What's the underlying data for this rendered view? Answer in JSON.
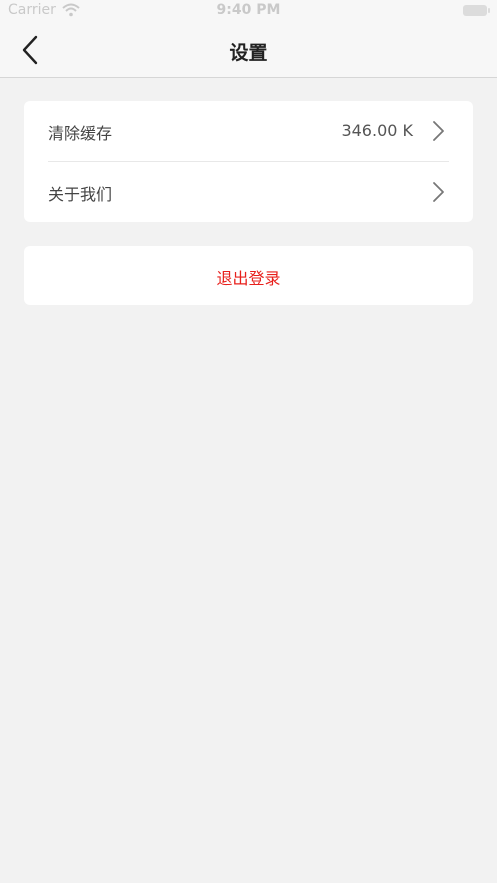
{
  "status_bar": {
    "carrier": "Carrier",
    "time": "9:40 PM",
    "wifi_icon": "wifi-icon",
    "battery_icon": "battery-icon"
  },
  "nav": {
    "title": "设置",
    "back_icon": "chevron-left-icon"
  },
  "settings": {
    "items": [
      {
        "label": "清除缓存",
        "value": "346.00 K",
        "icon": "chevron-right-icon"
      },
      {
        "label": "关于我们",
        "value": "",
        "icon": "chevron-right-icon"
      }
    ]
  },
  "logout": {
    "label": "退出登录",
    "color": "#e8201c"
  },
  "colors": {
    "background": "#f2f2f2",
    "card": "#ffffff",
    "nav_bar": "#f7f7f7"
  }
}
